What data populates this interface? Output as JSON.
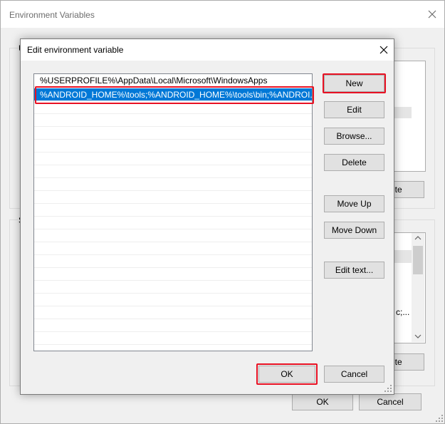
{
  "background_window": {
    "title": "Environment Variables",
    "user_group_label_partial": "U",
    "system_group_label_partial": "S",
    "delete_label_partial_top": "ete",
    "delete_label_partial_bottom": "ete",
    "system_list_partial_text": "c;...",
    "ok_label": "OK",
    "cancel_label": "Cancel"
  },
  "dialog": {
    "title": "Edit environment variable",
    "entries": [
      "%USERPROFILE%\\AppData\\Local\\Microsoft\\WindowsApps",
      "%ANDROID_HOME%\\tools;%ANDROID_HOME%\\tools\\bin;%ANDROI..."
    ],
    "selected_index": 1,
    "buttons": {
      "new": "New",
      "edit": "Edit",
      "browse": "Browse...",
      "delete": "Delete",
      "move_up": "Move Up",
      "move_down": "Move Down",
      "edit_text": "Edit text...",
      "ok": "OK",
      "cancel": "Cancel"
    }
  },
  "colors": {
    "selection": "#0078d7",
    "annotation_highlight": "#e81123",
    "button_face": "#e1e1e1",
    "window_bg": "#f0f0f0"
  }
}
